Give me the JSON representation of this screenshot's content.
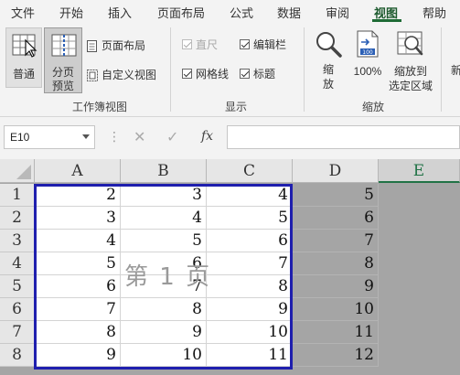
{
  "menu": {
    "items": [
      "文件",
      "开始",
      "插入",
      "页面布局",
      "公式",
      "数据",
      "审阅",
      "视图",
      "帮助"
    ],
    "active": "视图"
  },
  "ribbon": {
    "workbook_views": {
      "normal": "普通",
      "page_break_preview_1": "分页",
      "page_break_preview_2": "预览",
      "page_layout": "页面布局",
      "custom_views": "自定义视图",
      "group_label": "工作簿视图"
    },
    "show": {
      "ruler": "直尺",
      "formula_bar": "编辑栏",
      "gridlines": "网格线",
      "headings": "标题",
      "group_label": "显示"
    },
    "zoom": {
      "zoom_1": "缩",
      "zoom_2": "放",
      "hundred": "100%",
      "to_selection_1": "缩放到",
      "to_selection_2": "选定区域",
      "group_label": "缩放",
      "cut_off": "新"
    }
  },
  "formula_bar": {
    "name_box": "E10",
    "fx": "fx",
    "value": ""
  },
  "sheet": {
    "columns": [
      "A",
      "B",
      "C",
      "D",
      "E"
    ],
    "selected_column": "E",
    "rows": [
      "1",
      "2",
      "3",
      "4",
      "5",
      "6",
      "7",
      "8"
    ],
    "cells": [
      [
        "2",
        "3",
        "4",
        "5"
      ],
      [
        "3",
        "4",
        "5",
        "6"
      ],
      [
        "4",
        "5",
        "6",
        "7"
      ],
      [
        "5",
        "6",
        "7",
        "8"
      ],
      [
        "6",
        "7",
        "8",
        "9"
      ],
      [
        "7",
        "8",
        "9",
        "10"
      ],
      [
        "8",
        "9",
        "10",
        "11"
      ],
      [
        "9",
        "10",
        "11",
        "12"
      ]
    ],
    "page_watermark": "第 1 页"
  },
  "colors": {
    "accent_green": "#217346",
    "page_border": "#1f1fae",
    "outside_print_area": "#a5a5a5"
  }
}
